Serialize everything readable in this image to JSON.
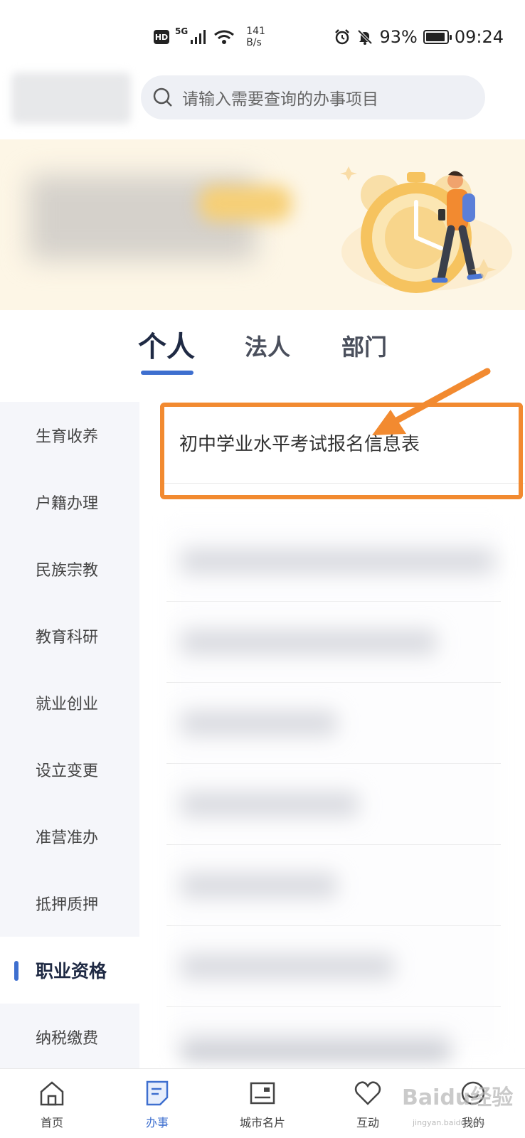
{
  "status_bar": {
    "hd": "HD",
    "network": "5G",
    "speed_value": "141",
    "speed_unit": "B/s",
    "battery": "93%",
    "battery_level": 0.93,
    "time": "09:24"
  },
  "search": {
    "placeholder": "请输入需要查询的办事项目"
  },
  "tabs": [
    {
      "label": "个人",
      "active": true
    },
    {
      "label": "法人",
      "active": false
    },
    {
      "label": "部门",
      "active": false
    }
  ],
  "sidebar": {
    "items": [
      {
        "label": "生育收养",
        "active": false
      },
      {
        "label": "户籍办理",
        "active": false
      },
      {
        "label": "民族宗教",
        "active": false
      },
      {
        "label": "教育科研",
        "active": false
      },
      {
        "label": "就业创业",
        "active": false
      },
      {
        "label": "设立变更",
        "active": false
      },
      {
        "label": "准营准办",
        "active": false
      },
      {
        "label": "抵押质押",
        "active": false
      },
      {
        "label": "职业资格",
        "active": true
      },
      {
        "label": "纳税缴费",
        "active": false
      }
    ]
  },
  "content": {
    "highlighted_item": "初中学业水平考试报名信息表"
  },
  "bottom_nav": {
    "items": [
      {
        "label": "首页",
        "icon": "home-icon",
        "active": false
      },
      {
        "label": "办事",
        "icon": "document-icon",
        "active": true
      },
      {
        "label": "城市名片",
        "icon": "card-icon",
        "active": false
      },
      {
        "label": "互动",
        "icon": "heart-icon",
        "active": false
      },
      {
        "label": "我的",
        "icon": "profile-icon",
        "active": false
      }
    ]
  },
  "watermark": {
    "text": "Baidu经验",
    "sub": "jingyan.baidu.com"
  },
  "colors": {
    "accent": "#3e6fcf",
    "highlight": "#f28a30",
    "banner_bg": "#fdf6e6",
    "sidebar_bg": "#f5f6fa"
  }
}
